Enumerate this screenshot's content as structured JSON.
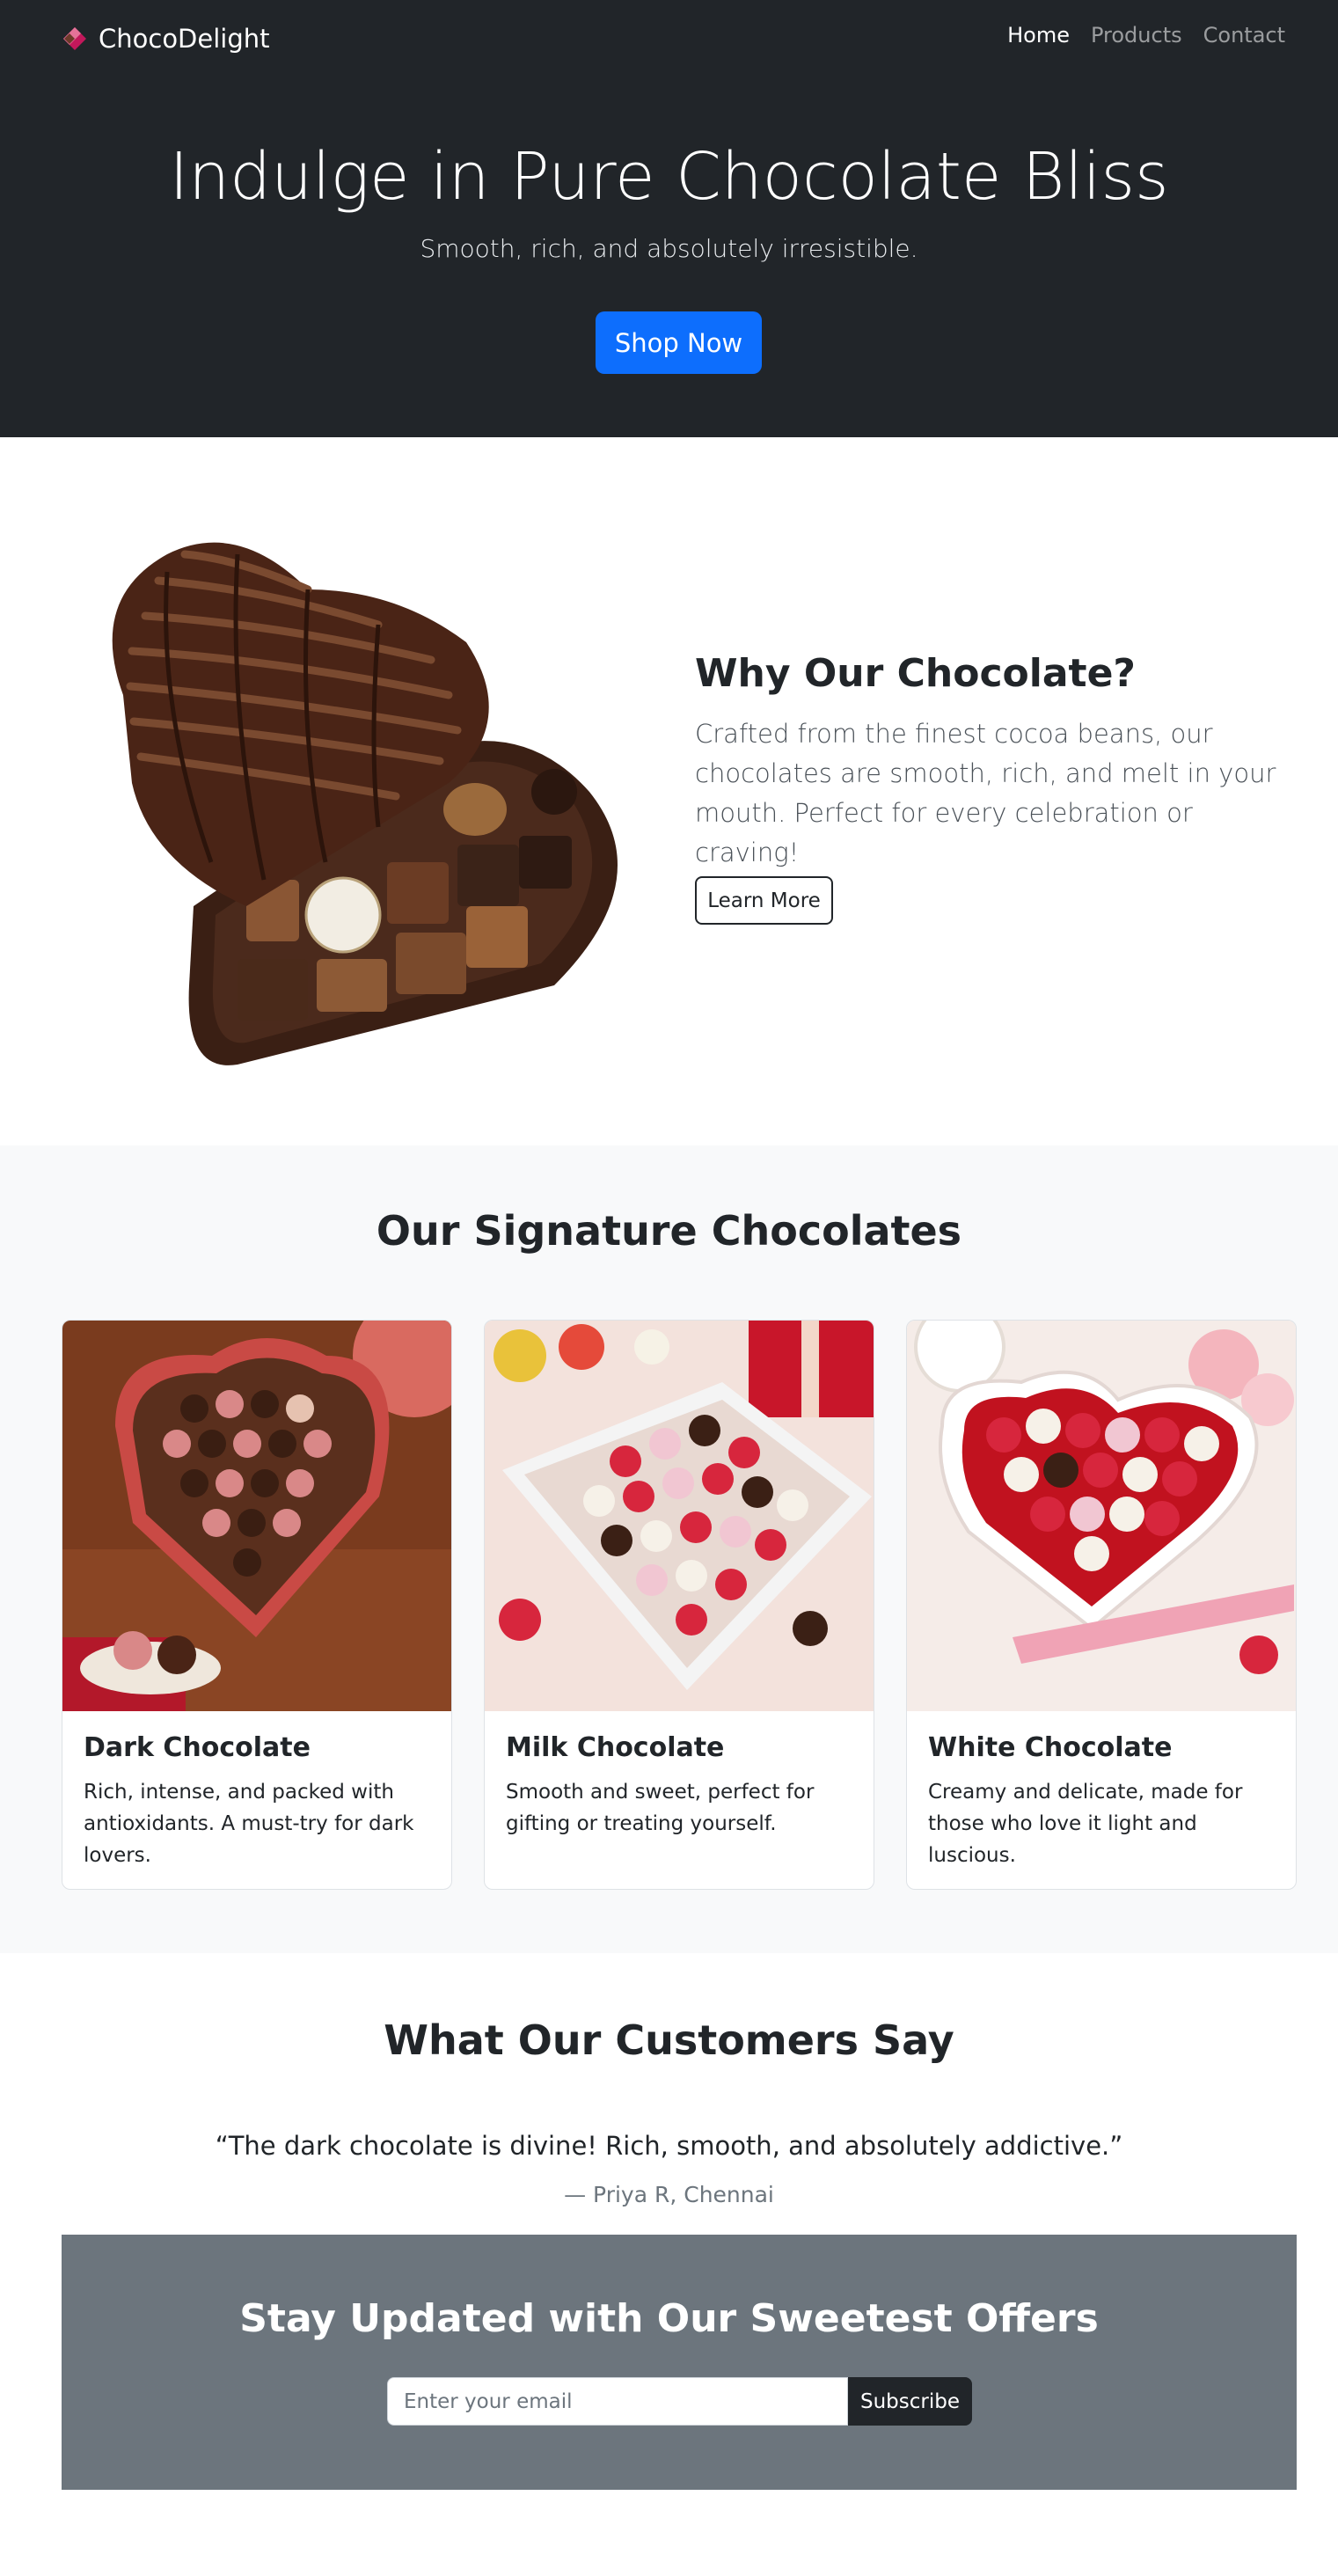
{
  "navbar": {
    "brand": "ChocoDelight",
    "links": [
      "Home",
      "Products",
      "Contact"
    ]
  },
  "hero": {
    "title": "Indulge in Pure Chocolate Bliss",
    "subtitle": "Smooth, rich, and absolutely irresistible.",
    "button": "Shop Now"
  },
  "why": {
    "title": "Why Our Chocolate?",
    "text": "Crafted from the finest cocoa beans, our chocolates are smooth, rich, and melt in your mouth. Perfect for every celebration or craving!",
    "button": "Learn More"
  },
  "signature": {
    "title": "Our Signature Chocolates",
    "cards": [
      {
        "title": "Dark Chocolate",
        "text": "Rich, intense, and packed with antioxidants. A must-try for dark lovers."
      },
      {
        "title": "Milk Chocolate",
        "text": "Smooth and sweet, perfect for gifting or treating yourself."
      },
      {
        "title": "White Chocolate",
        "text": "Creamy and delicate, made for those who love it light and luscious."
      }
    ]
  },
  "testimonial": {
    "title": "What Our Customers Say",
    "quote": "“The dark chocolate is divine! Rich, smooth, and absolutely addictive.”",
    "author": "— Priya R, Chennai"
  },
  "newsletter": {
    "title": "Stay Updated with Our Sweetest Offers",
    "placeholder": "Enter your email",
    "button": "Subscribe"
  },
  "colors": {
    "dark": "#212529",
    "primary": "#0d6efd",
    "gray": "#6c757d",
    "light": "#f8f9fa"
  }
}
